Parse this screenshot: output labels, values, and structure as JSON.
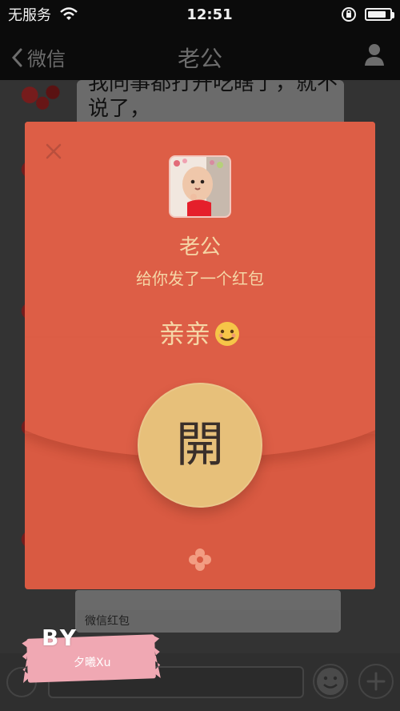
{
  "status_bar": {
    "carrier": "无服务",
    "time": "12:51",
    "battery_level": 0.86
  },
  "nav": {
    "back_label": "微信",
    "title": "老公"
  },
  "chat": {
    "message_line1": "我同事都打开吃瞎了，就不",
    "message_line2": "说了，"
  },
  "red_packet": {
    "sender_name": "老公",
    "subtitle": "给你发了一个红包",
    "blessing": "亲亲",
    "open_label": "開"
  },
  "bottom_card": {
    "title": "微信红包"
  },
  "watermark": {
    "by": "BY",
    "name": "夕曦Xu"
  },
  "colors": {
    "packet_red": "#d95a42",
    "packet_gold": "#e7c07a",
    "packet_text": "#f5d6a6"
  }
}
